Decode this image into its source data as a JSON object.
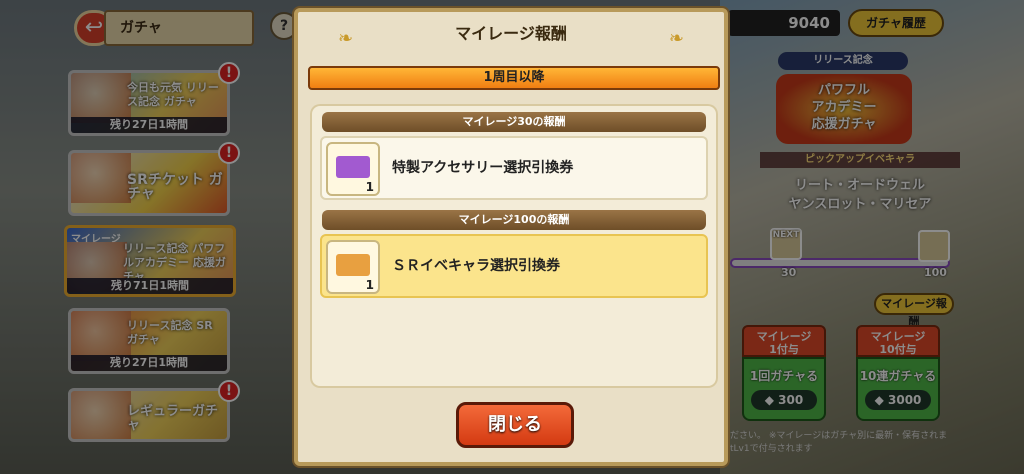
{
  "header": {
    "title": "ガチャ",
    "help": "?"
  },
  "banners": [
    {
      "tag": "",
      "title": "今日も元気 リリース記念 ガチャ",
      "timer": "残り27日1時間",
      "badge": "!"
    },
    {
      "tag": "",
      "title": "SRチケット ガチャ",
      "timer": "",
      "badge": "!"
    },
    {
      "tag": "マイレージ",
      "title": "リリース記念 パワフルアカデミー 応援ガチャ",
      "timer": "残り71日1時間",
      "badge": "!"
    },
    {
      "tag": "",
      "title": "リリース記念 SRガチャ",
      "timer": "残り27日1時間",
      "badge": ""
    },
    {
      "tag": "",
      "title": "レギュラーガチャ",
      "timer": "",
      "badge": "!"
    }
  ],
  "topbar": {
    "currency_value": "9040",
    "history_label": "ガチャ履歴"
  },
  "featured": {
    "release_tag": "リリース記念",
    "logo_line1": "パワフル",
    "logo_line2": "アカデミー",
    "logo_line3": "応援ガチャ",
    "pickup_label": "ピックアップイベキャラ",
    "pickup_name1": "リート・オードウェル",
    "pickup_name2": "ヤンスロット・マリセア",
    "progress_mid": "30",
    "progress_end": "100",
    "next_label": "NEXT",
    "mileage_button": "マイレージ報酬"
  },
  "pulls": [
    {
      "header_line1": "マイレージ",
      "header_line2": "1付与",
      "label": "1回ガチャる",
      "cost": "300"
    },
    {
      "header_line1": "マイレージ",
      "header_line2": "10付与",
      "label": "10連ガチャる",
      "cost": "3000"
    }
  ],
  "footnote": "ださい。 ※マイレージはガチャ別に最新・保有されま tLv1で付与されます",
  "modal": {
    "title": "マイレージ報酬",
    "subtitle": "1周目以降",
    "sections": [
      {
        "header": "マイレージ30の報酬",
        "reward_name": "特製アクセサリー選択引換券",
        "count": "1"
      },
      {
        "header": "マイレージ100の報酬",
        "reward_name": "ＳＲイベキャラ選択引換券",
        "count": "1"
      }
    ],
    "close_label": "閉じる"
  },
  "colors": {
    "accent_orange": "#f07e12",
    "close_red": "#d43a12",
    "selected_yellow": "#fbe48c",
    "pull_green": "#4fb848"
  }
}
